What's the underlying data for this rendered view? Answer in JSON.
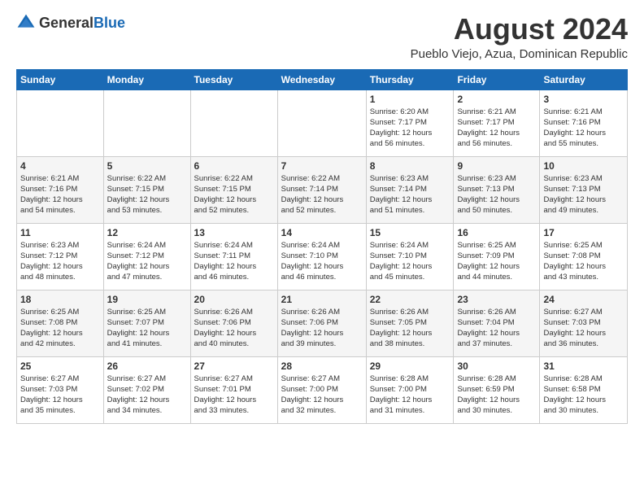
{
  "header": {
    "logo_general": "General",
    "logo_blue": "Blue",
    "title": "August 2024",
    "location": "Pueblo Viejo, Azua, Dominican Republic"
  },
  "calendar": {
    "days_of_week": [
      "Sunday",
      "Monday",
      "Tuesday",
      "Wednesday",
      "Thursday",
      "Friday",
      "Saturday"
    ],
    "weeks": [
      [
        {
          "day": "",
          "info": ""
        },
        {
          "day": "",
          "info": ""
        },
        {
          "day": "",
          "info": ""
        },
        {
          "day": "",
          "info": ""
        },
        {
          "day": "1",
          "info": "Sunrise: 6:20 AM\nSunset: 7:17 PM\nDaylight: 12 hours\nand 56 minutes."
        },
        {
          "day": "2",
          "info": "Sunrise: 6:21 AM\nSunset: 7:17 PM\nDaylight: 12 hours\nand 56 minutes."
        },
        {
          "day": "3",
          "info": "Sunrise: 6:21 AM\nSunset: 7:16 PM\nDaylight: 12 hours\nand 55 minutes."
        }
      ],
      [
        {
          "day": "4",
          "info": "Sunrise: 6:21 AM\nSunset: 7:16 PM\nDaylight: 12 hours\nand 54 minutes."
        },
        {
          "day": "5",
          "info": "Sunrise: 6:22 AM\nSunset: 7:15 PM\nDaylight: 12 hours\nand 53 minutes."
        },
        {
          "day": "6",
          "info": "Sunrise: 6:22 AM\nSunset: 7:15 PM\nDaylight: 12 hours\nand 52 minutes."
        },
        {
          "day": "7",
          "info": "Sunrise: 6:22 AM\nSunset: 7:14 PM\nDaylight: 12 hours\nand 52 minutes."
        },
        {
          "day": "8",
          "info": "Sunrise: 6:23 AM\nSunset: 7:14 PM\nDaylight: 12 hours\nand 51 minutes."
        },
        {
          "day": "9",
          "info": "Sunrise: 6:23 AM\nSunset: 7:13 PM\nDaylight: 12 hours\nand 50 minutes."
        },
        {
          "day": "10",
          "info": "Sunrise: 6:23 AM\nSunset: 7:13 PM\nDaylight: 12 hours\nand 49 minutes."
        }
      ],
      [
        {
          "day": "11",
          "info": "Sunrise: 6:23 AM\nSunset: 7:12 PM\nDaylight: 12 hours\nand 48 minutes."
        },
        {
          "day": "12",
          "info": "Sunrise: 6:24 AM\nSunset: 7:12 PM\nDaylight: 12 hours\nand 47 minutes."
        },
        {
          "day": "13",
          "info": "Sunrise: 6:24 AM\nSunset: 7:11 PM\nDaylight: 12 hours\nand 46 minutes."
        },
        {
          "day": "14",
          "info": "Sunrise: 6:24 AM\nSunset: 7:10 PM\nDaylight: 12 hours\nand 46 minutes."
        },
        {
          "day": "15",
          "info": "Sunrise: 6:24 AM\nSunset: 7:10 PM\nDaylight: 12 hours\nand 45 minutes."
        },
        {
          "day": "16",
          "info": "Sunrise: 6:25 AM\nSunset: 7:09 PM\nDaylight: 12 hours\nand 44 minutes."
        },
        {
          "day": "17",
          "info": "Sunrise: 6:25 AM\nSunset: 7:08 PM\nDaylight: 12 hours\nand 43 minutes."
        }
      ],
      [
        {
          "day": "18",
          "info": "Sunrise: 6:25 AM\nSunset: 7:08 PM\nDaylight: 12 hours\nand 42 minutes."
        },
        {
          "day": "19",
          "info": "Sunrise: 6:25 AM\nSunset: 7:07 PM\nDaylight: 12 hours\nand 41 minutes."
        },
        {
          "day": "20",
          "info": "Sunrise: 6:26 AM\nSunset: 7:06 PM\nDaylight: 12 hours\nand 40 minutes."
        },
        {
          "day": "21",
          "info": "Sunrise: 6:26 AM\nSunset: 7:06 PM\nDaylight: 12 hours\nand 39 minutes."
        },
        {
          "day": "22",
          "info": "Sunrise: 6:26 AM\nSunset: 7:05 PM\nDaylight: 12 hours\nand 38 minutes."
        },
        {
          "day": "23",
          "info": "Sunrise: 6:26 AM\nSunset: 7:04 PM\nDaylight: 12 hours\nand 37 minutes."
        },
        {
          "day": "24",
          "info": "Sunrise: 6:27 AM\nSunset: 7:03 PM\nDaylight: 12 hours\nand 36 minutes."
        }
      ],
      [
        {
          "day": "25",
          "info": "Sunrise: 6:27 AM\nSunset: 7:03 PM\nDaylight: 12 hours\nand 35 minutes."
        },
        {
          "day": "26",
          "info": "Sunrise: 6:27 AM\nSunset: 7:02 PM\nDaylight: 12 hours\nand 34 minutes."
        },
        {
          "day": "27",
          "info": "Sunrise: 6:27 AM\nSunset: 7:01 PM\nDaylight: 12 hours\nand 33 minutes."
        },
        {
          "day": "28",
          "info": "Sunrise: 6:27 AM\nSunset: 7:00 PM\nDaylight: 12 hours\nand 32 minutes."
        },
        {
          "day": "29",
          "info": "Sunrise: 6:28 AM\nSunset: 7:00 PM\nDaylight: 12 hours\nand 31 minutes."
        },
        {
          "day": "30",
          "info": "Sunrise: 6:28 AM\nSunset: 6:59 PM\nDaylight: 12 hours\nand 30 minutes."
        },
        {
          "day": "31",
          "info": "Sunrise: 6:28 AM\nSunset: 6:58 PM\nDaylight: 12 hours\nand 30 minutes."
        }
      ]
    ]
  }
}
